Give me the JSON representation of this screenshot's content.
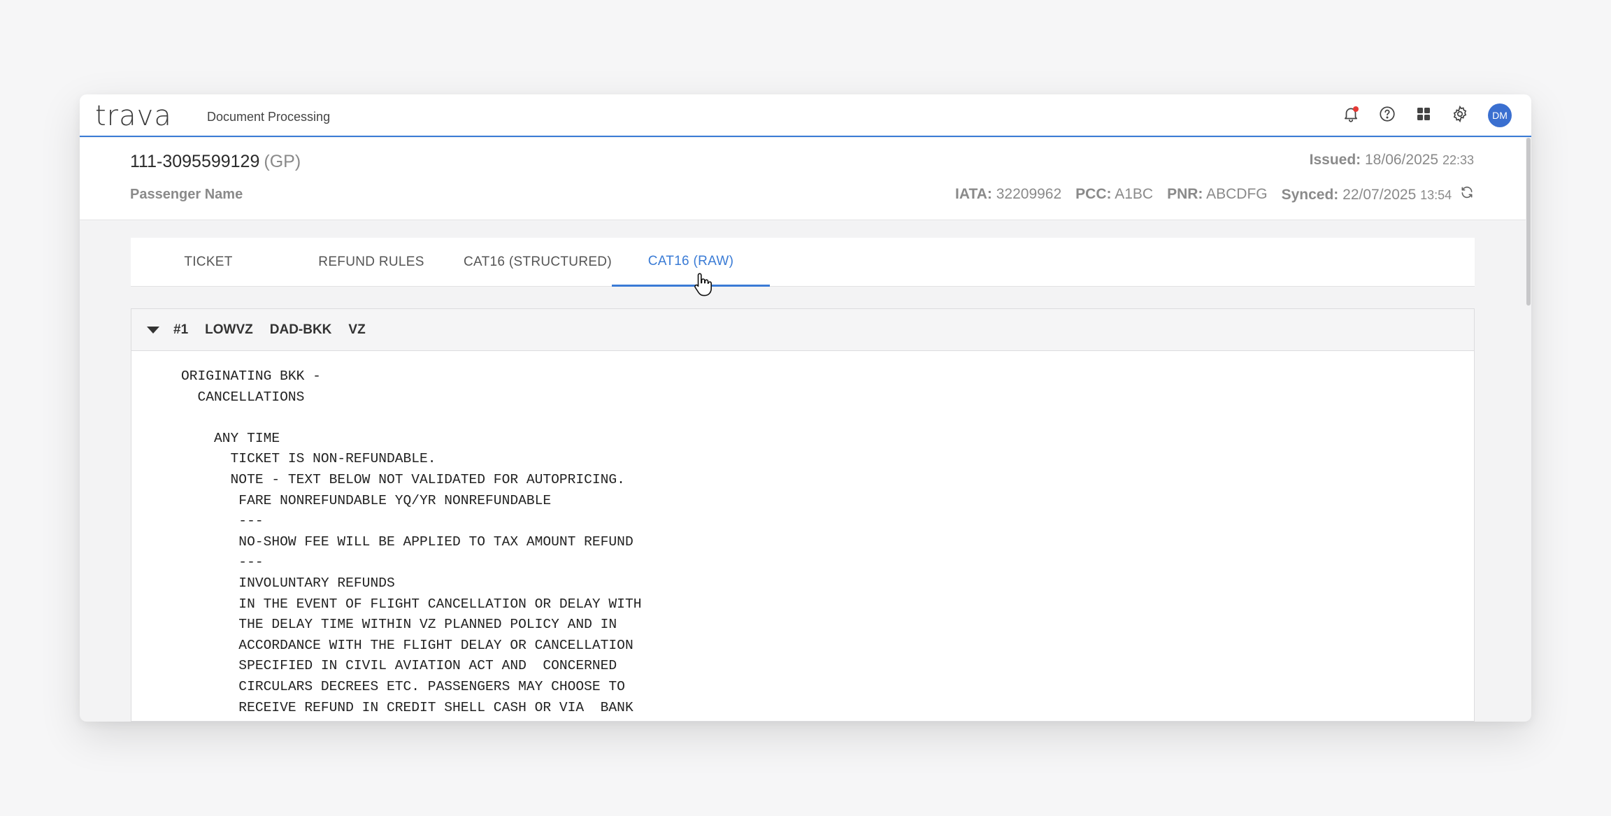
{
  "app": {
    "logo_text": "trava",
    "title": "Document Processing",
    "avatar_initials": "DM",
    "accent_color": "#3a7bd5",
    "icons": [
      "bell-icon",
      "help-icon",
      "apps-grid-icon",
      "gear-icon"
    ]
  },
  "ticket": {
    "number": "111-3095599129",
    "suffix": "(GP)",
    "passenger_label": "Passenger Name",
    "issued_label": "Issued:",
    "issued_date": "18/06/2025",
    "issued_time": "22:33",
    "iata_label": "IATA:",
    "iata_value": "32209962",
    "pcc_label": "PCC:",
    "pcc_value": "A1BC",
    "pnr_label": "PNR:",
    "pnr_value": "ABCDFG",
    "synced_label": "Synced:",
    "synced_date": "22/07/2025",
    "synced_time": "13:54"
  },
  "tabs": [
    {
      "label": "TICKET"
    },
    {
      "label": "REFUND RULES"
    },
    {
      "label": "CAT16 (STRUCTURED)"
    },
    {
      "label": "CAT16 (RAW)",
      "active": true
    }
  ],
  "rule": {
    "index": "#1",
    "fare_basis": "LOWVZ",
    "route": "DAD-BKK",
    "carrier": "VZ",
    "raw_text": "ORIGINATING BKK -\n  CANCELLATIONS\n\n    ANY TIME\n      TICKET IS NON-REFUNDABLE.\n      NOTE - TEXT BELOW NOT VALIDATED FOR AUTOPRICING.\n       FARE NONREFUNDABLE YQ/YR NONREFUNDABLE\n       ---\n       NO-SHOW FEE WILL BE APPLIED TO TAX AMOUNT REFUND\n       ---\n       INVOLUNTARY REFUNDS\n       IN THE EVENT OF FLIGHT CANCELLATION OR DELAY WITH\n       THE DELAY TIME WITHIN VZ PLANNED POLICY AND IN\n       ACCORDANCE WITH THE FLIGHT DELAY OR CANCELLATION\n       SPECIFIED IN CIVIL AVIATION ACT AND  CONCERNED\n       CIRCULARS DECREES ETC. PASSENGERS MAY CHOOSE TO\n       RECEIVE REFUND IN CREDIT SHELL CASH OR VIA  BANK\n       TRANSFER. CASH REFUNDS ARE MADE AT OUR AUTHORIZED"
  }
}
